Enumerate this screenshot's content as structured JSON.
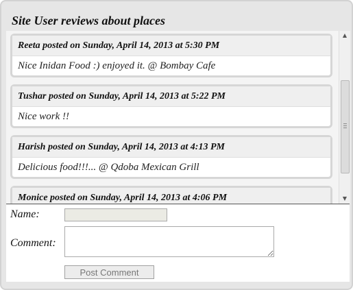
{
  "panel": {
    "title": "Site User reviews about places"
  },
  "reviews": [
    {
      "header": "Reeta posted on Sunday, April 14, 2013 at 5:30 PM",
      "text": "Nice Inidan Food :) enjoyed it. @ Bombay Cafe"
    },
    {
      "header": "Tushar posted on Sunday, April 14, 2013 at 5:22 PM",
      "text": "Nice work !!"
    },
    {
      "header": "Harish posted on Sunday, April 14, 2013 at 4:13 PM",
      "text": "Delicious food!!!... @ Qdoba Mexican Grill"
    },
    {
      "header": "Monice posted on Sunday, April 14, 2013 at 4:06 PM",
      "text": ""
    }
  ],
  "scrollbar": {
    "up_icon": "triangle-up",
    "down_icon": "triangle-down"
  },
  "form": {
    "name_label": "Name:",
    "name_value": "",
    "comment_label": "Comment:",
    "comment_value": "",
    "post_button_label": "Post Comment"
  },
  "colors": {
    "panel_background": "#e6e6e6",
    "card_border": "#d6d6d6",
    "card_header_background": "#efefef"
  }
}
